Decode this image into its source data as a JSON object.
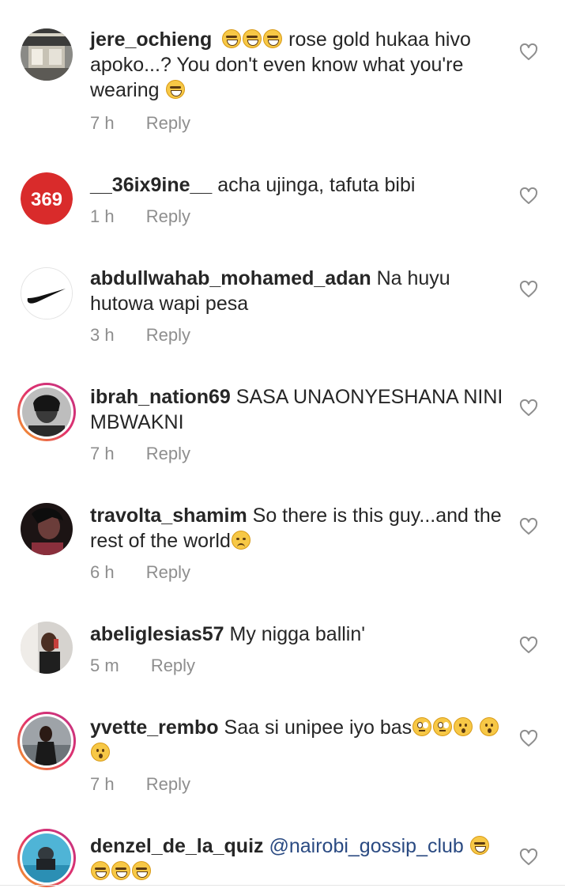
{
  "comments": [
    {
      "username": "jere_ochieng",
      "lead_emojis": [
        "laugh",
        "laugh",
        "laugh"
      ],
      "text": " rose gold hukaa hivo apoko...? You don't even know what you're wearing",
      "trail_emojis": [
        "laugh"
      ],
      "time": "7 h",
      "reply_label": "Reply",
      "avatar_icon": "office-interior-photo"
    },
    {
      "username": "__36ix9ine__",
      "text": " acha ujinga, tafuta bibi",
      "time": "1 h",
      "reply_label": "Reply",
      "avatar_text": "369",
      "avatar_color": "#d92b2b"
    },
    {
      "username": "abdullwahab_mohamed_adan",
      "text": " Na huyu hutowa wapi pesa",
      "time": "3 h",
      "reply_label": "Reply",
      "avatar_icon": "nike-swoosh-logo"
    },
    {
      "username": "ibrah_nation69",
      "text": " SASA UNAONYESHANA NINI MBWAKNI",
      "time": "7 h",
      "reply_label": "Reply",
      "avatar_icon": "portrait-photo"
    },
    {
      "username": "travolta_shamim",
      "text": " So there is this guy...and the rest of the world",
      "trail_emojis": [
        "cry"
      ],
      "time": "6 h",
      "reply_label": "Reply",
      "avatar_icon": "portrait-photo"
    },
    {
      "username": "abeliglesias57",
      "text": " My nigga ballin'",
      "time": "5 m",
      "reply_label": "Reply",
      "avatar_icon": "portrait-photo"
    },
    {
      "username": "yvette_rembo",
      "text": " Saa si unipee iyo bas",
      "trail_emojis": [
        "eyeroll",
        "eyeroll",
        "wow",
        "wow",
        "wow"
      ],
      "time": "7 h",
      "reply_label": "Reply",
      "avatar_icon": "portrait-photo"
    },
    {
      "username": "denzel_de_la_quiz",
      "mention": " @nairobi_gossip_club",
      "trail_emojis": [
        "laugh",
        "laugh",
        "laugh",
        "laugh"
      ],
      "avatar_icon": "portrait-photo"
    }
  ],
  "colors": {
    "text": "#262626",
    "meta": "#8e8e8e",
    "mention": "#2a4a82",
    "heart_stroke": "#8e8e8e"
  },
  "icons": {
    "like": "heart-outline-icon"
  }
}
